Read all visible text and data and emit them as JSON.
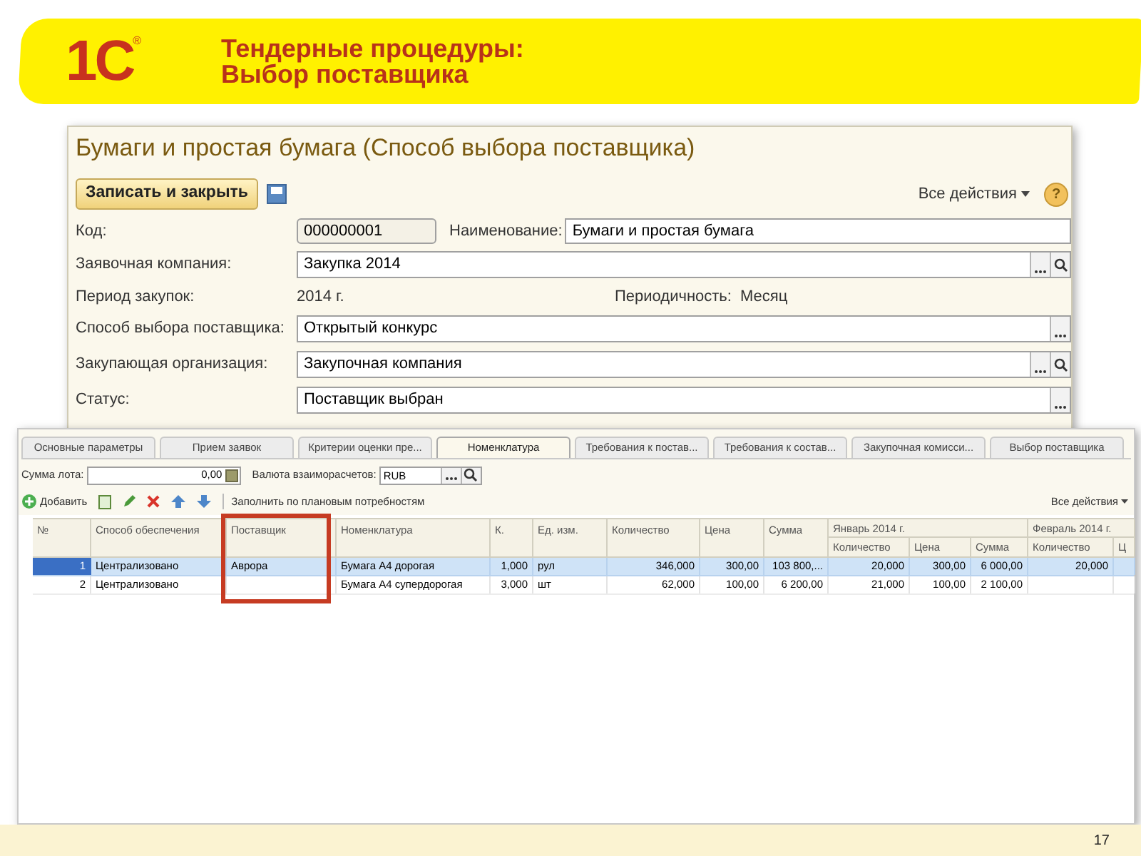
{
  "slide": {
    "logo": "1С",
    "logo_mark": "®",
    "title_lines": [
      "Тендерные процедуры:",
      "Выбор поставщика"
    ],
    "page_number": "17"
  },
  "form": {
    "title": "Бумаги и простая бумага (Способ выбора поставщика)",
    "save_button": "Записать и закрыть",
    "all_actions": "Все действия",
    "help": "?",
    "rows": [
      {
        "kind": "code",
        "label": "Код:",
        "value": "000000001",
        "label_2": "Наименование:",
        "value_2": "Бумаги и простая бумага"
      },
      {
        "kind": "select",
        "label": "Заявочная компания:",
        "value": "Закупка 2014"
      },
      {
        "kind": "static",
        "label": "Период закупок:",
        "value": "2014 г.",
        "label_2": "Периодичность:",
        "value_2": "Месяц"
      },
      {
        "kind": "choice",
        "label": "Способ выбора поставщика:",
        "value": "Открытый конкурс"
      },
      {
        "kind": "select",
        "label": "Закупающая организация:",
        "value": "Закупочная компания"
      },
      {
        "kind": "choice",
        "label": "Статус:",
        "value": "Поставщик выбран"
      }
    ]
  },
  "detail": {
    "tabs": [
      {
        "label": "Основные параметры",
        "selected": false
      },
      {
        "label": "Прием заявок",
        "selected": false
      },
      {
        "label": "Критерии оценки пре...",
        "selected": false
      },
      {
        "label": "Номенклатура",
        "selected": true
      },
      {
        "label": "Требования к постав...",
        "selected": false
      },
      {
        "label": "Требования к состав...",
        "selected": false
      },
      {
        "label": "Закупочная комисси...",
        "selected": false
      },
      {
        "label": "Выбор поставщика",
        "selected": false
      }
    ],
    "lot_sum": {
      "label": "Сумма лота:",
      "value": "0,00"
    },
    "currency": {
      "label": "Валюта взаиморасчетов:",
      "value": "RUB"
    },
    "toolbar": {
      "add": "Добавить",
      "fill": "Заполнить по плановым потребностям",
      "all_actions": "Все действия"
    },
    "table": {
      "columns": [
        {
          "label": "№",
          "highlighted": false
        },
        {
          "label": "Способ обеспечения",
          "highlighted": false
        },
        {
          "label": "Поставщик",
          "highlighted": true
        },
        {
          "label": "Номенклатура",
          "highlighted": false
        },
        {
          "label": "К.",
          "highlighted": false
        },
        {
          "label": "Ед. изм.",
          "highlighted": false
        },
        {
          "label": "Количество",
          "highlighted": false
        },
        {
          "label": "Цена",
          "highlighted": false
        },
        {
          "label": "Сумма",
          "highlighted": false
        }
      ],
      "column_groups": [
        {
          "label": "Январь 2014 г.",
          "children": [
            {
              "label": "Количество"
            },
            {
              "label": "Цена"
            },
            {
              "label": "Сумма"
            }
          ]
        },
        {
          "label": "Февраль 2014 г.",
          "children": [
            {
              "label": "Количество"
            },
            {
              "label": "Ц"
            }
          ]
        }
      ],
      "rows": [
        {
          "selected": true,
          "cells": [
            "1",
            "Централизовано",
            "Аврора",
            "Бумага А4 дорогая",
            "1,000",
            "рул",
            "346,000",
            "300,00",
            "103 800,...",
            "20,000",
            "300,00",
            "6 000,00",
            "20,000",
            null
          ]
        },
        {
          "selected": false,
          "cells": [
            "2",
            "Централизовано",
            null,
            "Бумага А4 супердорогая",
            "3,000",
            "шт",
            "62,000",
            "100,00",
            "6 200,00",
            "21,000",
            "100,00",
            "2 100,00",
            null,
            null
          ]
        }
      ]
    }
  }
}
